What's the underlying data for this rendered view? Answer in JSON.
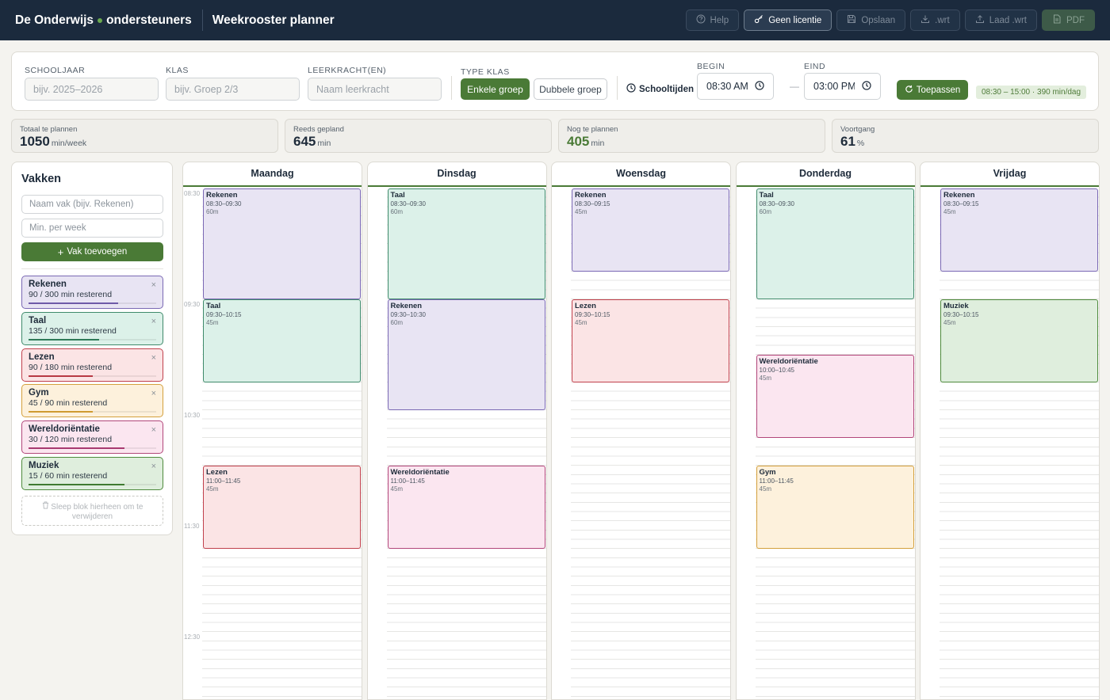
{
  "header": {
    "brand_left": "De Onderwijs",
    "brand_right": "ondersteuners",
    "app_title": "Weekrooster planner",
    "buttons": {
      "help": "Help",
      "license": "Geen licentie",
      "save": "Opslaan",
      "export_wrt": ".wrt",
      "load_wrt": "Laad .wrt",
      "pdf": "PDF"
    }
  },
  "settings": {
    "schooljaar_label": "SCHOOLJAAR",
    "schooljaar_placeholder": "bijv. 2025–2026",
    "klas_label": "KLAS",
    "klas_placeholder": "bijv. Groep 2/3",
    "leerkracht_label": "LEERKRACHT(EN)",
    "leerkracht_placeholder": "Naam leerkracht",
    "type_label": "TYPE KLAS",
    "type_single": "Enkele groep",
    "type_double": "Dubbele groep",
    "schooltijden_label": "Schooltijden",
    "begin_label": "BEGIN",
    "begin_value": "08:30 AM",
    "end_label": "EIND",
    "end_value": "03:00 PM",
    "dash": "—",
    "apply_label": "Toepassen",
    "summary": "08:30 – 15:00 · 390 min/dag"
  },
  "stats": [
    {
      "label": "Totaal te plannen",
      "value": "1050",
      "unit": "min/week"
    },
    {
      "label": "Reeds gepland",
      "value": "645",
      "unit": "min"
    },
    {
      "label": "Nog te plannen",
      "value": "405",
      "unit": "min"
    },
    {
      "label": "Voortgang",
      "value": "61",
      "unit": "%"
    }
  ],
  "sidebar": {
    "title": "Vakken",
    "name_placeholder": "Naam vak (bijv. Rekenen)",
    "minutes_placeholder": "Min. per week",
    "add_label": "Vak toevoegen",
    "close_glyph": "×",
    "drop_hint": "Sleep blok hierheen om te verwijderen",
    "subjects": [
      {
        "name": "Rekenen",
        "meta": "90 / 300 min resterend",
        "progress": 0.7,
        "border": "#7a68b4",
        "bg": "#e8e4f3",
        "bar": "#6e5aa8"
      },
      {
        "name": "Taal",
        "meta": "135 / 300 min resterend",
        "progress": 0.55,
        "border": "#3f8a6b",
        "bg": "#dcf1e9",
        "bar": "#2f7a58"
      },
      {
        "name": "Lezen",
        "meta": "90 / 180 min resterend",
        "progress": 0.5,
        "border": "#c0404c",
        "bg": "#fbe4e5",
        "bar": "#b83a44"
      },
      {
        "name": "Gym",
        "meta": "45 / 90 min resterend",
        "progress": 0.5,
        "border": "#d4a03c",
        "bg": "#fdf1dc",
        "bar": "#cf9a30"
      },
      {
        "name": "Wereldoriëntatie",
        "meta": "30 / 120 min resterend",
        "progress": 0.75,
        "border": "#b2467a",
        "bg": "#fbe6f0",
        "bar": "#a83a70"
      },
      {
        "name": "Muziek",
        "meta": "15 / 60 min resterend",
        "progress": 0.75,
        "border": "#4e8a3c",
        "bg": "#dfeedd",
        "bar": "#3f7a30"
      }
    ]
  },
  "schedule": {
    "time_labels": [
      "08:30",
      "09:30",
      "10:30",
      "11:30",
      "12:30"
    ],
    "days": [
      {
        "name": "Maandag",
        "blocks": [
          {
            "subject": "Rekenen",
            "time": "08:30–09:30",
            "minutes": "60m",
            "start": 0,
            "duration": 60,
            "color": 0
          },
          {
            "subject": "Taal",
            "time": "09:30–10:15",
            "minutes": "45m",
            "start": 60,
            "duration": 45,
            "color": 1
          },
          {
            "subject": "Lezen",
            "time": "11:00–11:45",
            "minutes": "45m",
            "start": 150,
            "duration": 45,
            "color": 2
          }
        ]
      },
      {
        "name": "Dinsdag",
        "blocks": [
          {
            "subject": "Taal",
            "time": "08:30–09:30",
            "minutes": "60m",
            "start": 0,
            "duration": 60,
            "color": 1
          },
          {
            "subject": "Rekenen",
            "time": "09:30–10:30",
            "minutes": "60m",
            "start": 60,
            "duration": 60,
            "color": 0
          },
          {
            "subject": "Wereldoriëntatie",
            "time": "11:00–11:45",
            "minutes": "45m",
            "start": 150,
            "duration": 45,
            "color": 4
          }
        ]
      },
      {
        "name": "Woensdag",
        "blocks": [
          {
            "subject": "Rekenen",
            "time": "08:30–09:15",
            "minutes": "45m",
            "start": 0,
            "duration": 45,
            "color": 0
          },
          {
            "subject": "Lezen",
            "time": "09:30–10:15",
            "minutes": "45m",
            "start": 60,
            "duration": 45,
            "color": 2
          }
        ]
      },
      {
        "name": "Donderdag",
        "blocks": [
          {
            "subject": "Taal",
            "time": "08:30–09:30",
            "minutes": "60m",
            "start": 0,
            "duration": 60,
            "color": 1
          },
          {
            "subject": "Wereldoriëntatie",
            "time": "10:00–10:45",
            "minutes": "45m",
            "start": 90,
            "duration": 45,
            "color": 4
          },
          {
            "subject": "Gym",
            "time": "11:00–11:45",
            "minutes": "45m",
            "start": 150,
            "duration": 45,
            "color": 3
          }
        ]
      },
      {
        "name": "Vrijdag",
        "blocks": [
          {
            "subject": "Rekenen",
            "time": "08:30–09:15",
            "minutes": "45m",
            "start": 0,
            "duration": 45,
            "color": 0
          },
          {
            "subject": "Muziek",
            "time": "09:30–10:15",
            "minutes": "45m",
            "start": 60,
            "duration": 45,
            "color": 5
          }
        ]
      }
    ]
  }
}
